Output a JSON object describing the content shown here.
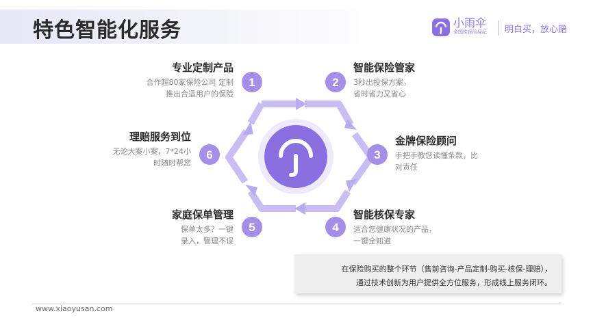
{
  "header": {
    "title": "特色智能化服务",
    "brand_name": "小雨伞",
    "brand_sub": "全国性保险经纪",
    "slogan": "明白买，放心赔"
  },
  "items": [
    {
      "number": "1",
      "title": "专业定制产品",
      "line1": "合作超80家保险公司 定制",
      "line2": "推出合适用户的保险"
    },
    {
      "number": "2",
      "title": "智能保险管家",
      "line1": "3秒出投保方案，",
      "line2": "省时省力又省心"
    },
    {
      "number": "3",
      "title": "金牌保险顾问",
      "line1": "手把手教您读懂条款，比",
      "line2": "对责任"
    },
    {
      "number": "4",
      "title": "智能核保专家",
      "line1": "适合您健康状况的产品，",
      "line2": "一键全知道"
    },
    {
      "number": "5",
      "title": "家庭保单管理",
      "line1": "保单太多？一键",
      "line2": "录入，管理不误"
    },
    {
      "number": "6",
      "title": "理赔服务到位",
      "line1": "无论大案小案，7*24小",
      "line2": "时随时帮您"
    }
  ],
  "callout": {
    "line1": "在保险购买的整个环节（售前咨询-产品定制-购买-核保-理赔），",
    "line2": "通过技术创新为用户提供全方位服务，形成线上服务闭环。"
  },
  "footer": {
    "url": "www.xiaoyusan.com"
  },
  "colors": {
    "accent": "#9b86e6",
    "accent_light": "#c9bdf3",
    "center": "#8a6fe0"
  },
  "icons": {
    "logo": "umbrella-icon",
    "center": "umbrella-icon"
  }
}
